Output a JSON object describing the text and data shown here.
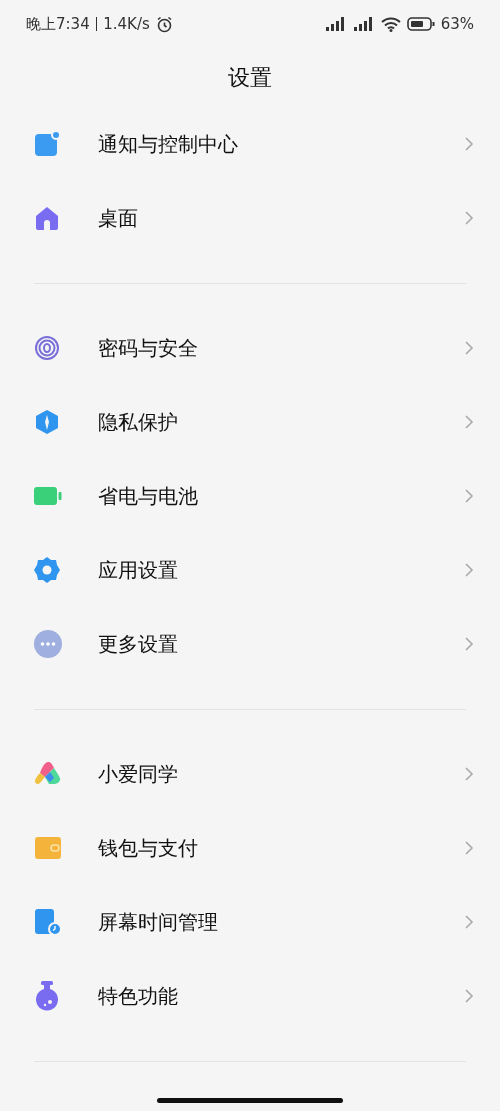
{
  "status_bar": {
    "time": "晚上7:34",
    "speed": "1.4K/s",
    "battery": "63%"
  },
  "title": "设置",
  "groups": [
    {
      "items": [
        {
          "label": "通知与控制中心",
          "kind": "notification"
        },
        {
          "label": "桌面",
          "kind": "home"
        }
      ]
    },
    {
      "items": [
        {
          "label": "密码与安全",
          "kind": "fingerprint"
        },
        {
          "label": "隐私保护",
          "kind": "privacy"
        },
        {
          "label": "省电与电池",
          "kind": "battery"
        },
        {
          "label": "应用设置",
          "kind": "gear"
        },
        {
          "label": "更多设置",
          "kind": "more"
        }
      ]
    },
    {
      "items": [
        {
          "label": "小爱同学",
          "kind": "assistant"
        },
        {
          "label": "钱包与支付",
          "kind": "wallet"
        },
        {
          "label": "屏幕时间管理",
          "kind": "screentime"
        },
        {
          "label": "特色功能",
          "kind": "flask"
        }
      ]
    }
  ]
}
